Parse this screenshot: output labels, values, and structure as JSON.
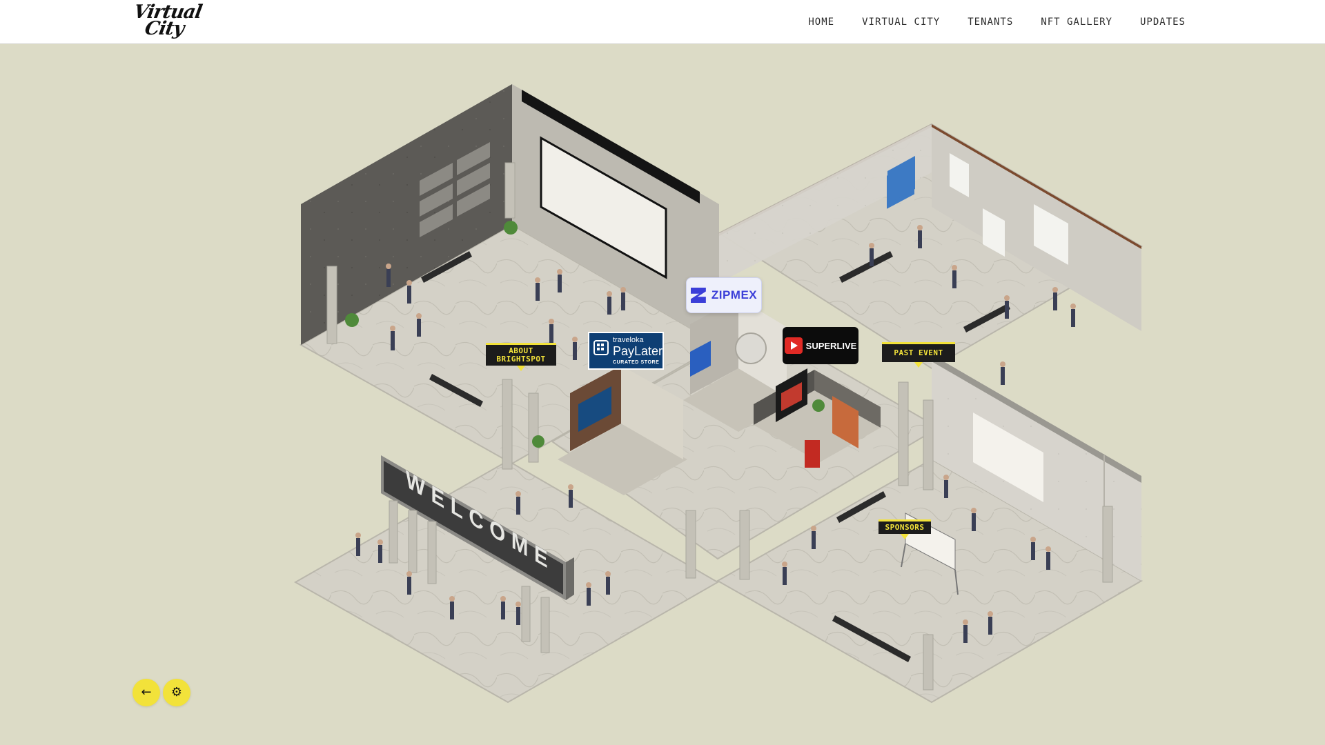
{
  "header": {
    "logo": {
      "line1": "Virtual",
      "line2": "City"
    },
    "nav": [
      {
        "label": "HOME"
      },
      {
        "label": "VIRTUAL CITY"
      },
      {
        "label": "TENANTS"
      },
      {
        "label": "NFT GALLERY"
      },
      {
        "label": "UPDATES"
      }
    ]
  },
  "scene": {
    "welcome_sign": "WELCOME",
    "tags": {
      "about": "ABOUT BRIGHTSPOT",
      "past_event": "PAST EVENT",
      "sponsors": "SPONSORS"
    },
    "badges": {
      "zipmex": "ZIPMEX",
      "paylater_brand": "traveloka",
      "paylater_name": "PayLater",
      "paylater_sub": "CURATED STORE",
      "superlive": "SUPERLIVE"
    }
  },
  "controls": {
    "back_icon": "arrow-left-icon",
    "settings_icon": "gear-icon"
  },
  "colors": {
    "background": "#dcdbc6",
    "accent": "#f2e23a",
    "tag_bg": "#1c1c1c"
  }
}
